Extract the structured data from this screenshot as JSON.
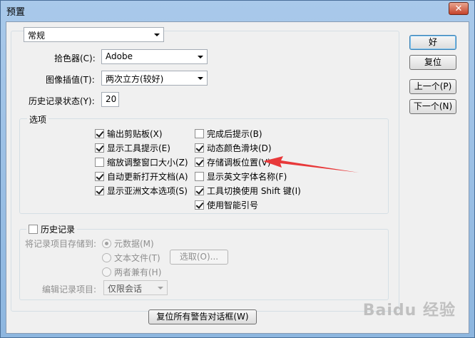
{
  "window": {
    "title": "预置",
    "close_glyph": "✕"
  },
  "preset": {
    "value": "常规"
  },
  "general": {
    "color_picker_label": "拾色器(C):",
    "color_picker_value": "Adobe",
    "interp_label": "图像插值(T):",
    "interp_value": "两次立方(较好)",
    "history_states_label": "历史记录状态(Y):",
    "history_states_value": "20"
  },
  "buttons": {
    "ok": "好",
    "reset": "复位",
    "prev": "上一个(P)",
    "next": "下一个(N)",
    "reset_warnings": "复位所有警告对话框(W)"
  },
  "options": {
    "title": "选项",
    "left": [
      {
        "label": "输出剪贴板(X)",
        "checked": true
      },
      {
        "label": "显示工具提示(E)",
        "checked": true
      },
      {
        "label": "缩放调整窗口大小(Z)",
        "checked": false
      },
      {
        "label": "自动更新打开文档(A)",
        "checked": true
      },
      {
        "label": "显示亚洲文本选项(S)",
        "checked": true
      }
    ],
    "right": [
      {
        "label": "完成后提示(B)",
        "checked": false
      },
      {
        "label": "动态颜色滑块(D)",
        "checked": true
      },
      {
        "label": "存储调板位置(V)",
        "checked": true
      },
      {
        "label": "显示英文字体名称(F)",
        "checked": false
      },
      {
        "label": "工具切换使用 Shift 键(I)",
        "checked": true
      },
      {
        "label": "使用智能引号",
        "checked": true
      }
    ]
  },
  "history": {
    "title": "历史记录",
    "checked": false,
    "save_to_label": "将记录项目存储到:",
    "radios": [
      {
        "label": "元数据(M)",
        "checked": true
      },
      {
        "label": "文本文件(T)",
        "checked": false
      },
      {
        "label": "两者兼有(H)",
        "checked": false
      }
    ],
    "choose_button": "选取(O)...",
    "edit_log_label": "编辑记录项目:",
    "edit_log_value": "仅限会话"
  },
  "watermark": "Baidu 经验",
  "annotation": {
    "color": "#e8393a"
  }
}
